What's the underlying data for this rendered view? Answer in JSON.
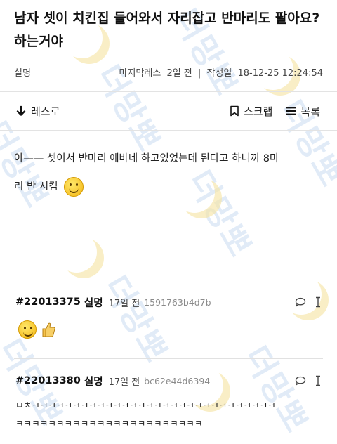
{
  "post": {
    "title": "남자 셋이 치킨집 들어와서 자리잡고 반마리도 팔아요? 하는거야",
    "author": "실명",
    "board": "마지막레스",
    "ago": "2일 전",
    "created_label": "작성일",
    "created": "18-12-25 12:24:54",
    "body_line1": "아—— 셋이서 반마리 에바네 하고있었는데 된다고 하니까 8마",
    "body_line2": "리 반 시킴"
  },
  "actions": {
    "down_label": "레스로",
    "scrap_label": "스크랩",
    "list_label": "목록"
  },
  "comments": [
    {
      "num": "#22013375",
      "name": "실명",
      "time": "17일 전",
      "hash": "1591763b4d7b",
      "text": ""
    },
    {
      "num": "#22013380",
      "name": "실명",
      "time": "17일 전",
      "hash": "bc62e44d6394",
      "text_line1": "ㅁㅊㅋㅋㅋㅋㅋㅋㅋㅋㅋㅋㅋㅋㅋㅋㅋㅋㅋㅋㅋㅋㅋㅋㅋㅋㅋㅋㅋㅋㅋㅋ",
      "text_line2": "ㅋㅋㅋㅋㅋㅋㅋㅋㅋㅋㅋㅋㅋㅋㅋㅋㅋㅋㅋㅋㅋㅋㅋ"
    }
  ],
  "watermark": {
    "text": "더망뽀",
    "color": "#c9dcf2"
  }
}
